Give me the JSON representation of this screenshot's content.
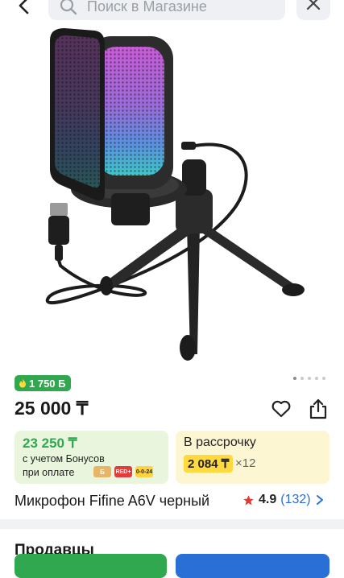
{
  "search": {
    "placeholder": "Поиск в Магазине"
  },
  "product": {
    "bonus_badge": "1 750 Б",
    "price": "25 000 ₸",
    "title": "Микрофон Fifine A6V черный",
    "rating": "4.9",
    "reviews": "(132)"
  },
  "bonus_card": {
    "amount": "23 250 ₸",
    "line1": "с учетом Бонусов",
    "line2": "при оплате",
    "chips": [
      "RED+",
      "0-0-24"
    ]
  },
  "installment_card": {
    "title": "В рассрочку",
    "amount": "2 084 ₸",
    "multiplier": "×12"
  },
  "sellers": {
    "heading": "Продавцы"
  },
  "gallery": {
    "pages": 5,
    "active": 0
  },
  "colors": {
    "green": "#2fa84f",
    "blue": "#2a6fd6",
    "yellow": "#ffd93d",
    "star": "#e53935"
  }
}
